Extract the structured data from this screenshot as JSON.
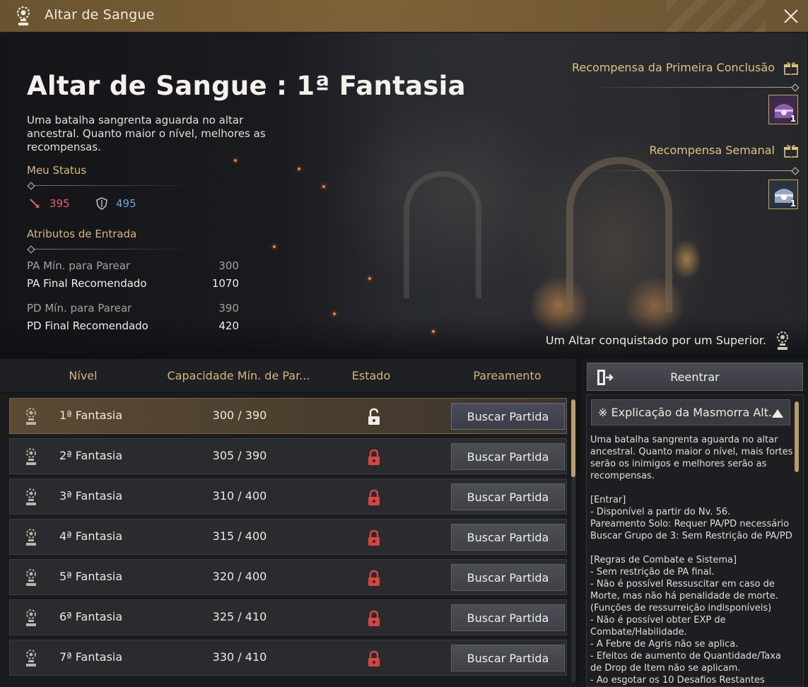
{
  "window": {
    "title": "Altar de Sangue"
  },
  "hero": {
    "title": "Altar de Sangue : 1ª Fantasia",
    "description": "Uma batalha sangrenta aguarda no altar ancestral. Quanto maior o nível, melhores as recompensas.",
    "status_label": "Meu Status",
    "ap_value": "395",
    "dp_value": "495",
    "entry_label": "Atributos de Entrada",
    "attributes": [
      {
        "label": "PA Mín. para Parear",
        "value": "300"
      },
      {
        "label": "PA Final Recomendado",
        "value": "1070"
      },
      {
        "label": "PD Mín. para Parear",
        "value": "390"
      },
      {
        "label": "PD Final Recomendado",
        "value": "420"
      }
    ],
    "first_clear_reward_label": "Recompensa da Primeira Conclusão",
    "first_clear_reward_count": "1",
    "weekly_reward_label": "Recompensa Semanal",
    "weekly_reward_count": "1",
    "occupied_text": "Um Altar conquistado por um Superior."
  },
  "table": {
    "headers": {
      "level": "Nível",
      "capacity": "Capacidade Mín. de Par...",
      "state": "Estado",
      "matching": "Pareamento"
    },
    "rows": [
      {
        "name": "1ª Fantasia",
        "capacity": "300 / 390",
        "locked": false,
        "button": "Buscar Partida"
      },
      {
        "name": "2ª Fantasia",
        "capacity": "305 / 390",
        "locked": true,
        "button": "Buscar Partida"
      },
      {
        "name": "3ª Fantasia",
        "capacity": "310 / 400",
        "locked": true,
        "button": "Buscar Partida"
      },
      {
        "name": "4ª Fantasia",
        "capacity": "315 / 400",
        "locked": true,
        "button": "Buscar Partida"
      },
      {
        "name": "5ª Fantasia",
        "capacity": "320 / 400",
        "locked": true,
        "button": "Buscar Partida"
      },
      {
        "name": "6ª Fantasia",
        "capacity": "325 / 410",
        "locked": true,
        "button": "Buscar Partida"
      },
      {
        "name": "7ª Fantasia",
        "capacity": "330 / 410",
        "locked": true,
        "button": "Buscar Partida"
      }
    ]
  },
  "side_panel": {
    "reenter_label": "Reentrar",
    "info_title": "※ Explicação da Masmorra Alt...",
    "info_text": "Uma batalha sangrenta aguarda no altar ancestral. Quanto maior o nível, mais fortes serão os inimigos e melhores serão as recompensas.\n\n[Entrar]\n- Disponível a partir do Nv. 56.\nPareamento Solo: Requer PA/PD necessário\nBuscar Grupo de 3: Sem Restrição de PA/PD\n\n[Regras de Combate e Sistema]\n- Sem restrição de PA final.\n- Não é possível Ressuscitar em caso de Morte, mas não há penalidade de morte. (Funções de ressurreição indisponíveis)\n- Não é possível obter EXP de Combate/Habilidade.\n- A Febre de Agris não se aplica.\n- Efeitos de aumento de Quantidade/Taxa de Drop de Item não se aplicam.\n- Ao esgotar os 10 Desafios Restantes"
  },
  "colors": {
    "accent_gold": "#d6b579",
    "ap_red": "#e0606a",
    "dp_blue": "#6aa7e6",
    "lock_red": "#d9443f"
  }
}
